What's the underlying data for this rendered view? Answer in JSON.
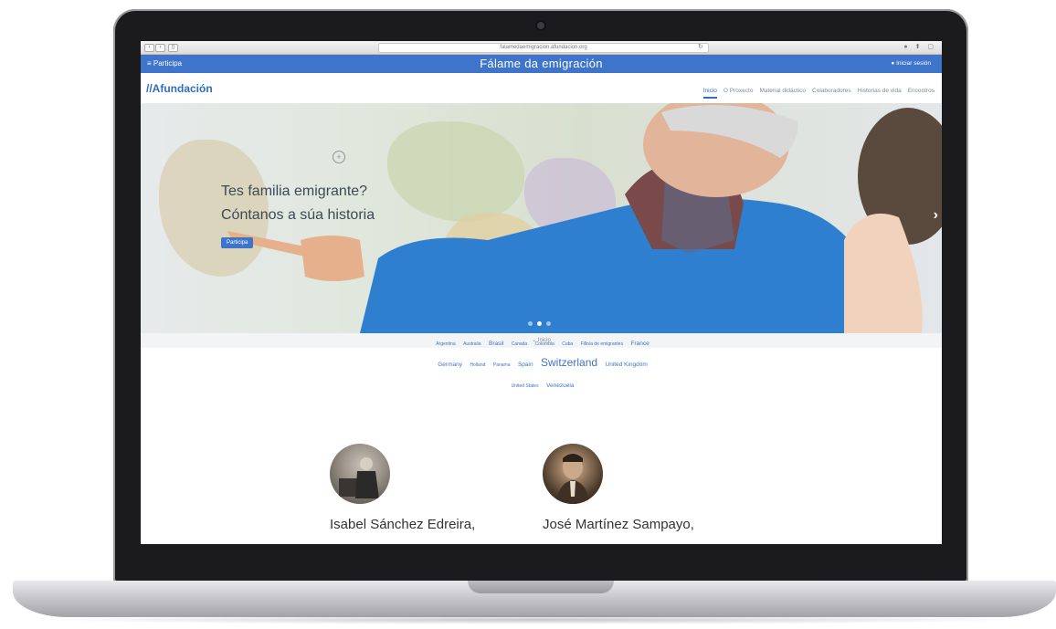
{
  "browser": {
    "url": "falamedaemigracion.afundacion.org",
    "reload_icon": "reload-icon",
    "controls": [
      "back-icon",
      "forward-icon",
      "sidebar-icon"
    ]
  },
  "topbar": {
    "participa": "Participa",
    "title": "Fálame da emigración",
    "login": "Iniciar sesión",
    "color": "#3e74c9"
  },
  "header": {
    "logo": "Afundación",
    "nav": [
      "Inicio",
      "O Proxecto",
      "Material didáctico",
      "Colaboradores",
      "Historias de vida",
      "Encontros"
    ],
    "active_index": 0
  },
  "hero": {
    "line1": "Tes familia emigrante?",
    "line2": "Cóntanos a súa historia",
    "button": "Participa",
    "slides_total": 3,
    "slide_active": 1
  },
  "scroll_hint": "Inicio",
  "tags": [
    {
      "text": "Argentina",
      "size": "xs"
    },
    {
      "text": "Australia",
      "size": "xs"
    },
    {
      "text": "Brasil",
      "size": "s"
    },
    {
      "text": "Canada",
      "size": "xs"
    },
    {
      "text": "Colombia",
      "size": "xs"
    },
    {
      "text": "Cuba",
      "size": "xs"
    },
    {
      "text": "Fillo/a de emigrantes",
      "size": "xs"
    },
    {
      "text": "France",
      "size": "s"
    },
    {
      "text": "Germany",
      "size": "s"
    },
    {
      "text": "Holland",
      "size": "xs"
    },
    {
      "text": "Panama",
      "size": "xs"
    },
    {
      "text": "Spain",
      "size": "s"
    },
    {
      "text": "Switzerland",
      "size": "l"
    },
    {
      "text": "United Kingdom",
      "size": "s"
    },
    {
      "text": "United States",
      "size": "xs"
    },
    {
      "text": "Venezuela",
      "size": "s"
    }
  ],
  "people": [
    {
      "name": "Isabel Sánchez Edreira,"
    },
    {
      "name": "José Martínez Sampayo,"
    }
  ]
}
